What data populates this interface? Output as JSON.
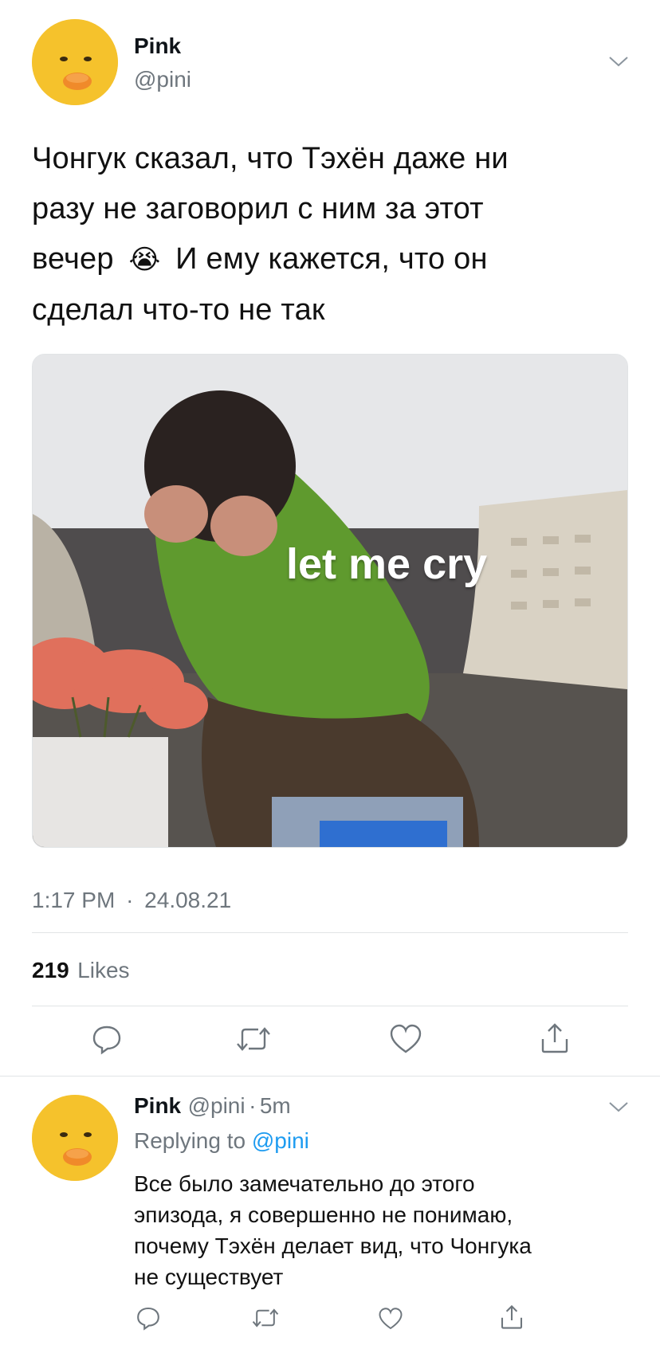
{
  "tweet": {
    "author_name": "Pink",
    "author_handle": "@pini",
    "text_lines": [
      "Чонгук сказал, что Тэхён даже ни",
      "разу не заговорил с ним за этот",
      "вечер",
      "И ему кажется, что он",
      "сделал что-то не так"
    ],
    "emoji": "😭",
    "media_caption": "let me cry",
    "time": "1:17 PM",
    "separator": "·",
    "date": "24.08.21",
    "likes_count": "219",
    "likes_label": "Likes"
  },
  "reply": {
    "author_name": "Pink",
    "author_handle": "@pini",
    "separator": "·",
    "age": "5m",
    "replying_prefix": "Replying to",
    "replying_handle": "@pini",
    "text_lines": [
      "Все было замечательно до этого",
      "эпизода, я совершенно не понимаю,",
      "почему Тэхён делает вид, что Чонгука",
      "не существует"
    ]
  },
  "icons": {
    "reply": "speech-bubble-icon",
    "retweet": "retweet-icon",
    "like": "heart-icon",
    "share": "share-icon",
    "more": "chevron-down-icon"
  },
  "colors": {
    "text": "#0f1419",
    "secondary": "#6e767d",
    "link": "#1d9bf0",
    "divider": "#e1e4e6"
  }
}
